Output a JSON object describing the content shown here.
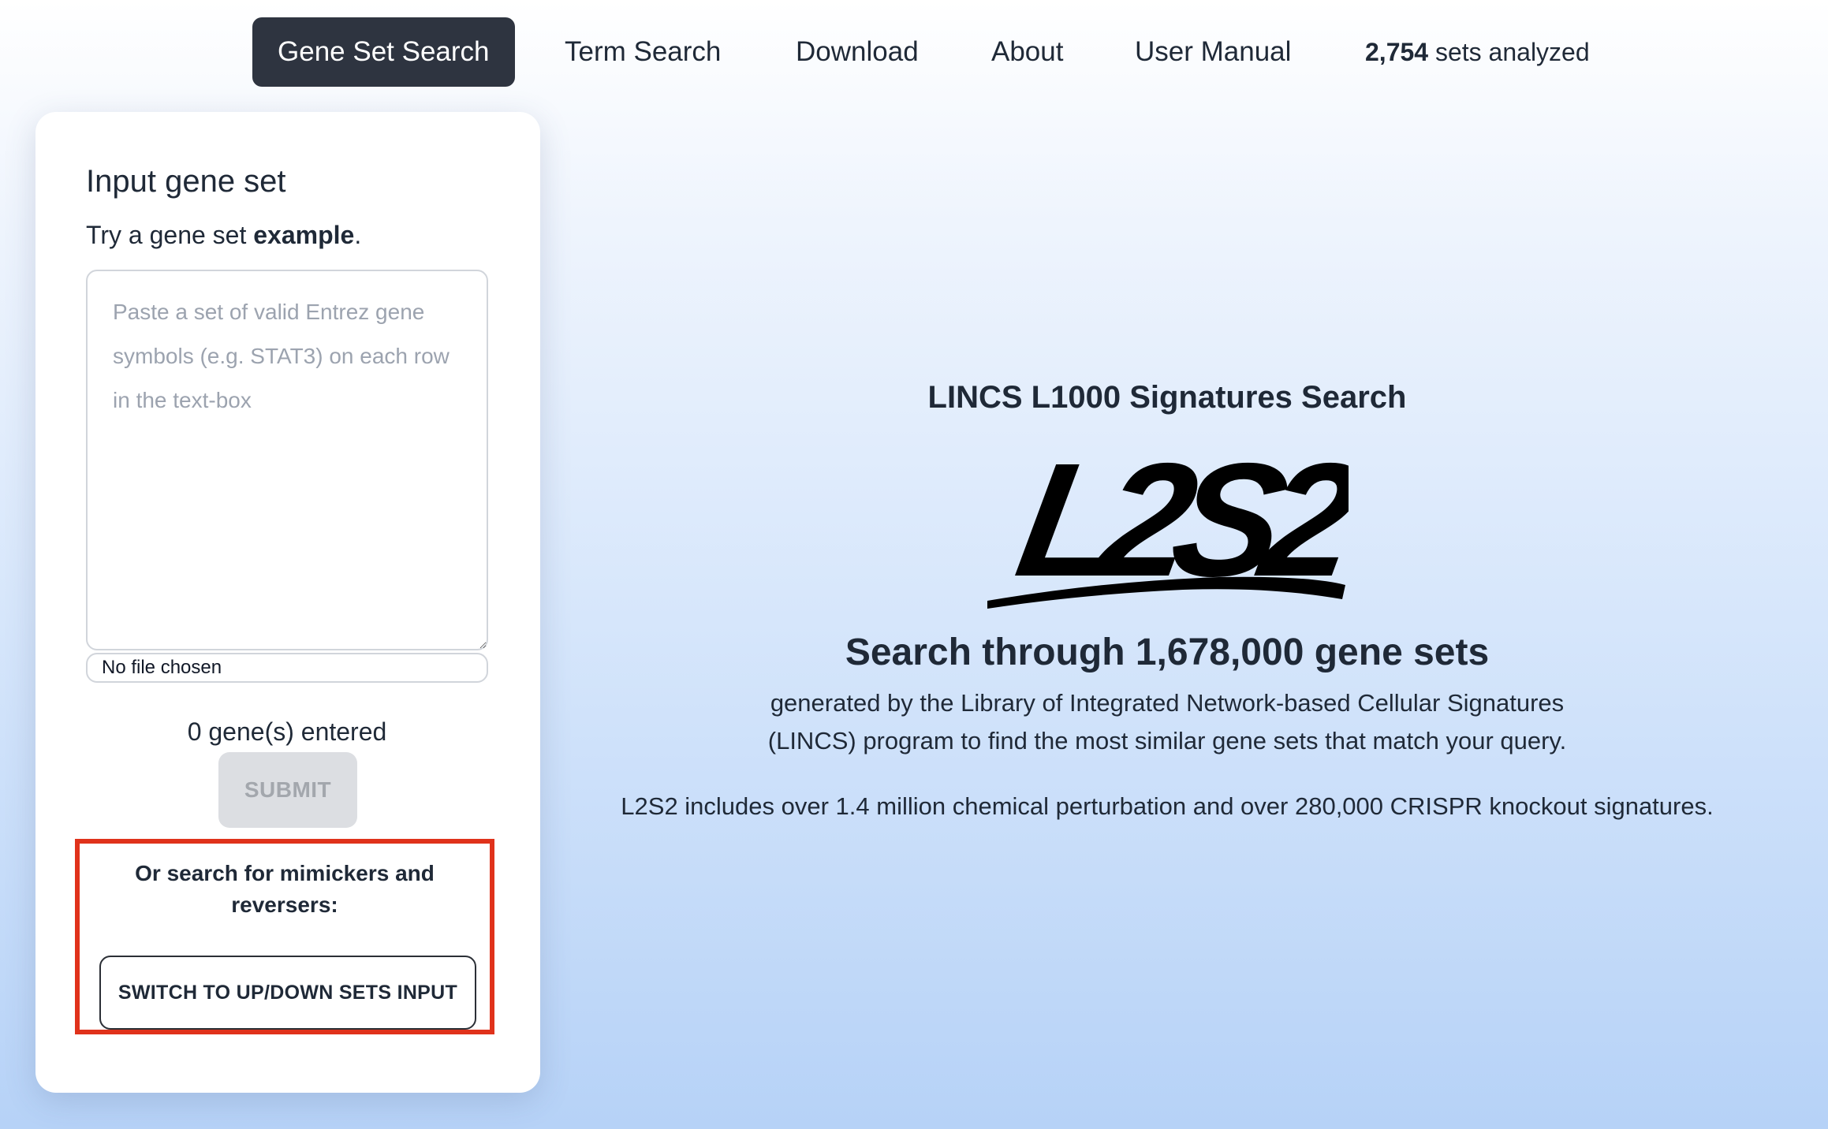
{
  "nav": {
    "items": [
      {
        "label": "Gene Set Search",
        "active": true
      },
      {
        "label": "Term Search"
      },
      {
        "label": "Download"
      },
      {
        "label": "About"
      },
      {
        "label": "User Manual"
      }
    ],
    "stat_count": "2,754",
    "stat_text": " sets analyzed"
  },
  "input_card": {
    "title": "Input gene set",
    "hint_prefix": "Try a gene set ",
    "hint_link": "example",
    "hint_suffix": ".",
    "textarea_placeholder": "Paste a set of valid Entrez gene symbols (e.g. STAT3) on each row in the text-box",
    "textarea_value": "",
    "file_status": "No file chosen",
    "gene_count_text": "0 gene(s) entered",
    "submit_label": "SUBMIT",
    "mimic_prompt": "Or search for mimickers and reversers:",
    "switch_label": "SWITCH TO UP/DOWN SETS INPUT"
  },
  "hero": {
    "title": "LINCS L1000 Signatures Search",
    "logo_text": "L2S2",
    "headline": "Search through 1,678,000 gene sets",
    "desc_line1": "generated by the Library of Integrated Network-based Cellular Signatures",
    "desc_line2": "(LINCS) program to find the most similar gene sets that match your query.",
    "note": "L2S2 includes over 1.4 million chemical perturbation and over 280,000 CRISPR knockout signatures."
  },
  "colors": {
    "active_nav_bg": "#2e3440",
    "highlight_border": "#e0321b",
    "submit_disabled_bg": "#dcdee2"
  }
}
